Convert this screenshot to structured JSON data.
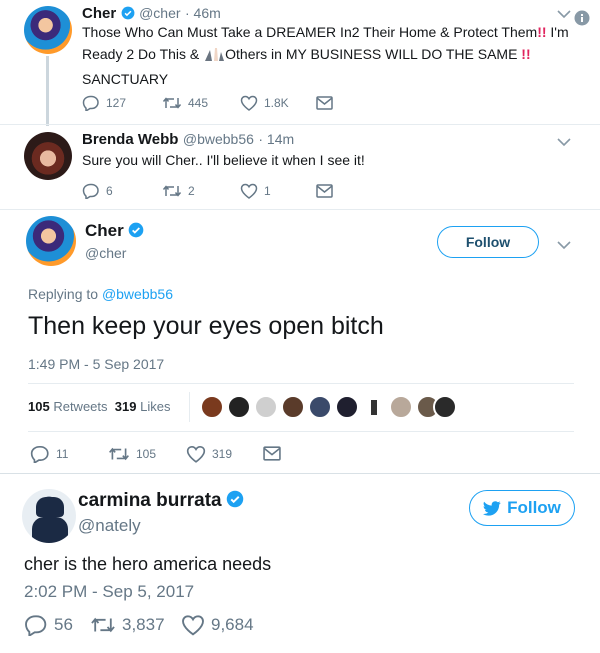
{
  "thread": {
    "tweet1": {
      "name": "Cher",
      "handle": "@cher",
      "time": "· 46m",
      "text_a": "Those Who Can Must Take a DREAMER In2 Their Home & Protect Them",
      "text_b": " I'm",
      "text_c": "Ready 2 Do This &",
      "text_d": "Others in MY BUSINESS WILL DO THE SAME",
      "text_e": "SANCTUARY",
      "bang": "!!",
      "replies": "127",
      "retweets": "445",
      "likes": "1.8K"
    },
    "tweet2": {
      "name": "Brenda Webb",
      "handle": "@bwebb56",
      "time": "· 14m",
      "text": "Sure you will Cher.. I'll believe it when I see it!",
      "replies": "6",
      "retweets": "2",
      "likes": "1"
    },
    "tweet3": {
      "name": "Cher",
      "handle": "@cher",
      "follow_label": "Follow",
      "replying_prefix": "Replying to ",
      "replying_handle": "@bwebb56",
      "text": "Then keep your eyes open bitch",
      "timestamp": "1:49 PM - 5 Sep 2017",
      "retweets_count": "105",
      "retweets_label": "Retweets",
      "likes_count": "319",
      "likes_label": "Likes",
      "replies": "11",
      "retweets": "105",
      "likes": "319"
    }
  },
  "quote": {
    "name": "carmina burrata",
    "handle": "@nately",
    "follow_label": "Follow",
    "text": "cher is the hero america needs",
    "timestamp": "2:02 PM - Sep 5, 2017",
    "replies": "56",
    "retweets": "3,837",
    "likes": "9,684"
  },
  "colors": {
    "brand_blue": "#1da1f2",
    "text_gray": "#657786",
    "emoji_red": "#e0245e"
  }
}
